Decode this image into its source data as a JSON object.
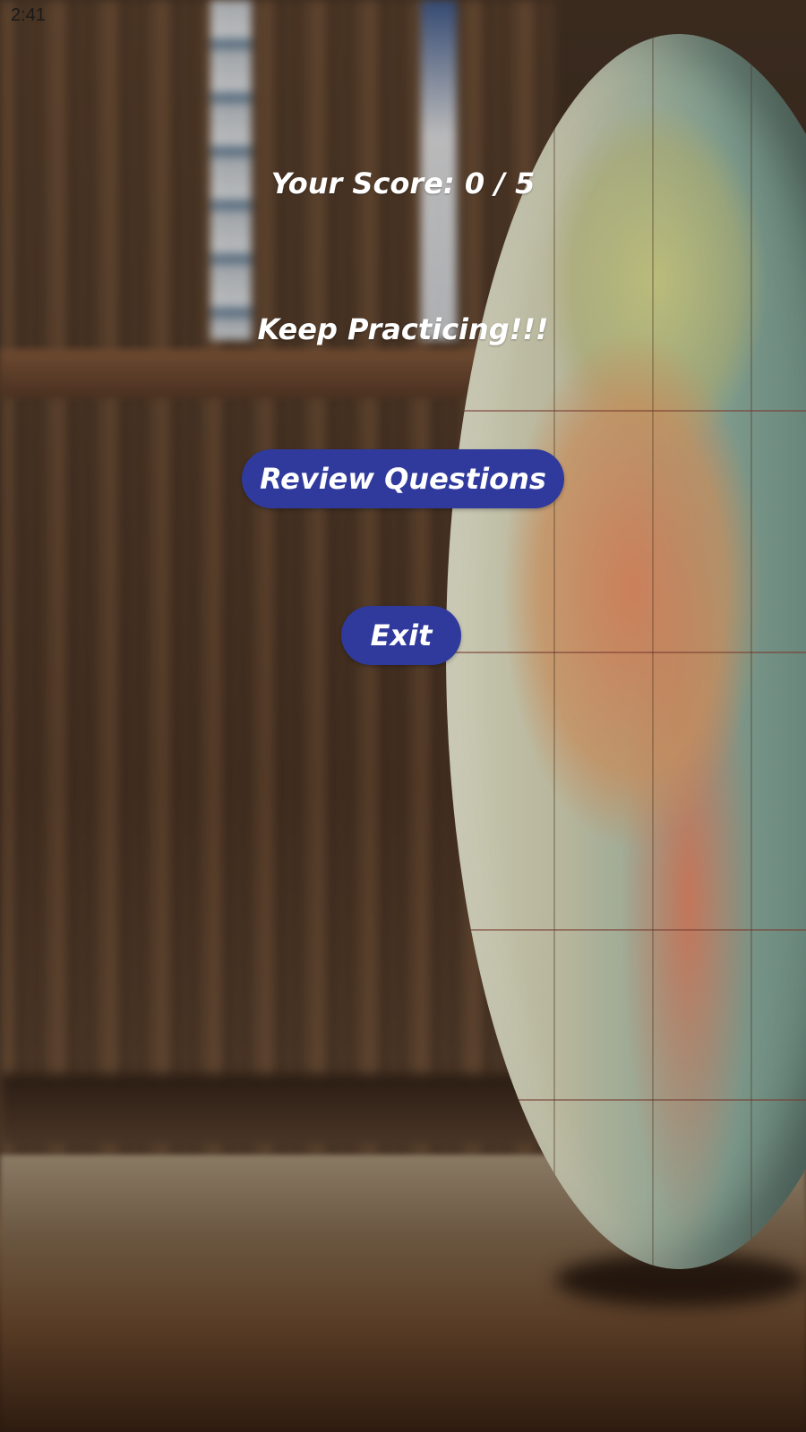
{
  "status_bar": {
    "time": "2:41"
  },
  "result": {
    "score_text": "Your Score: 0 / 5",
    "message": "Keep Practicing!!!"
  },
  "actions": {
    "review_label": "Review Questions",
    "exit_label": "Exit"
  },
  "colors": {
    "button_background": "#2f3a9c",
    "text": "#ffffff"
  },
  "background": {
    "description_icon": "globe-bookshelf-background"
  }
}
